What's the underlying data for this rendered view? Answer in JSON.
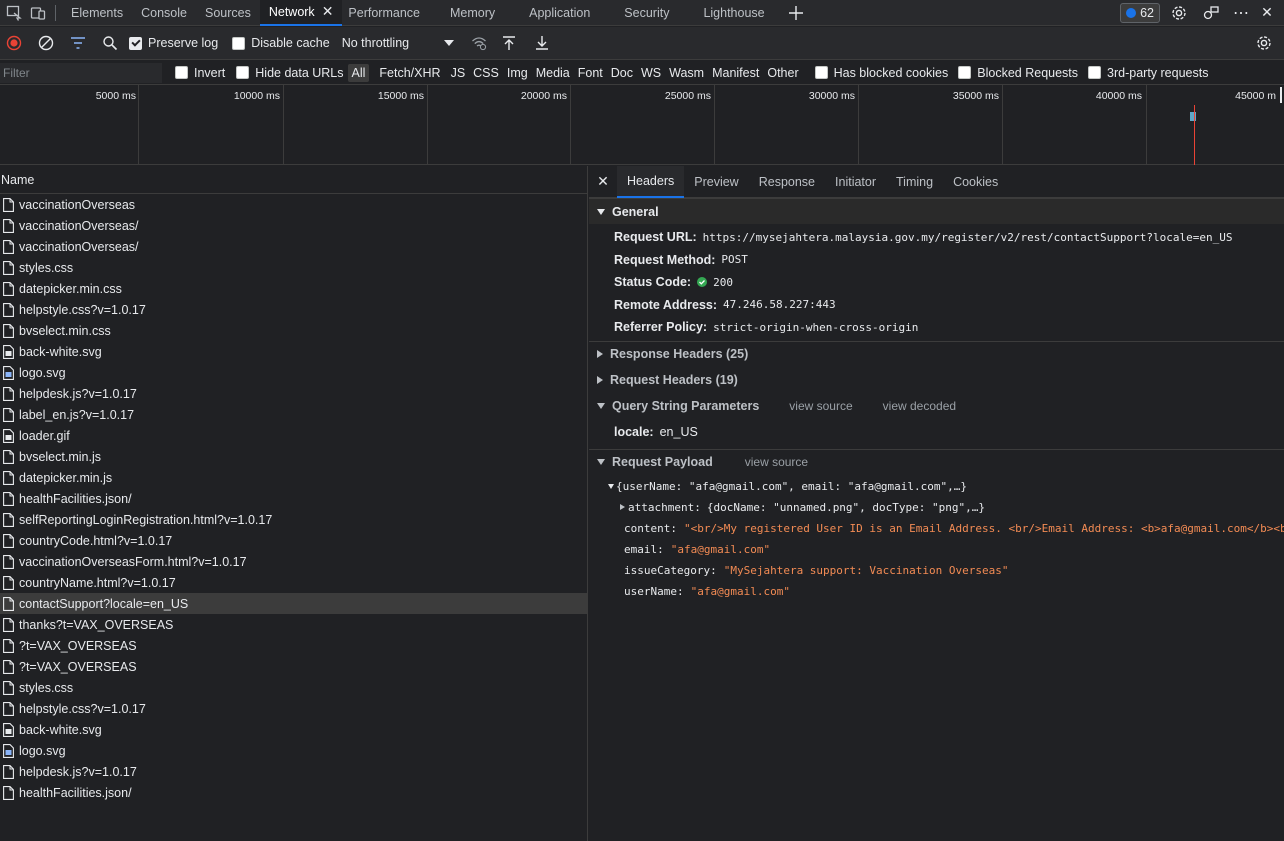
{
  "topbar": {
    "tabs": [
      {
        "label": "Elements",
        "active": false
      },
      {
        "label": "Console",
        "active": false
      },
      {
        "label": "Sources",
        "active": false
      },
      {
        "label": "Network",
        "active": true
      },
      {
        "label": "Performance",
        "active": false
      },
      {
        "label": "Memory",
        "active": false
      },
      {
        "label": "Application",
        "active": false
      },
      {
        "label": "Security",
        "active": false
      },
      {
        "label": "Lighthouse",
        "active": false
      }
    ],
    "issues_count": "62"
  },
  "toolbar": {
    "preserve_log_label": "Preserve log",
    "preserve_log_checked": true,
    "disable_cache_label": "Disable cache",
    "disable_cache_checked": false,
    "throttling": "No throttling"
  },
  "filterbar": {
    "filter_placeholder": "Filter",
    "invert_label": "Invert",
    "hide_data_urls_label": "Hide data URLs",
    "types": [
      "All",
      "Fetch/XHR",
      "JS",
      "CSS",
      "Img",
      "Media",
      "Font",
      "Doc",
      "WS",
      "Wasm",
      "Manifest",
      "Other"
    ],
    "active_type": "All",
    "has_blocked_cookies_label": "Has blocked cookies",
    "blocked_requests_label": "Blocked Requests",
    "third_party_label": "3rd-party requests"
  },
  "overview": {
    "ticks": [
      "5000 ms",
      "10000 ms",
      "15000 ms",
      "20000 ms",
      "25000 ms",
      "30000 ms",
      "35000 ms",
      "40000 ms",
      "45000 m"
    ]
  },
  "list": {
    "header": "Name",
    "rows": [
      {
        "name": "vaccinationOverseas",
        "icon": "doc-icon"
      },
      {
        "name": "vaccinationOverseas/",
        "icon": "doc-icon"
      },
      {
        "name": "vaccinationOverseas/",
        "icon": "doc-icon"
      },
      {
        "name": "styles.css",
        "icon": "doc-icon"
      },
      {
        "name": "datepicker.min.css",
        "icon": "doc-icon"
      },
      {
        "name": "helpstyle.css?v=1.0.17",
        "icon": "doc-icon"
      },
      {
        "name": "bvselect.min.css",
        "icon": "doc-icon"
      },
      {
        "name": "back-white.svg",
        "icon": "image-icon"
      },
      {
        "name": "logo.svg",
        "icon": "image-color-icon"
      },
      {
        "name": "helpdesk.js?v=1.0.17",
        "icon": "doc-icon"
      },
      {
        "name": "label_en.js?v=1.0.17",
        "icon": "doc-icon"
      },
      {
        "name": "loader.gif",
        "icon": "image-icon"
      },
      {
        "name": "bvselect.min.js",
        "icon": "doc-icon"
      },
      {
        "name": "datepicker.min.js",
        "icon": "doc-icon"
      },
      {
        "name": "healthFacilities.json/",
        "icon": "doc-icon"
      },
      {
        "name": "selfReportingLoginRegistration.html?v=1.0.17",
        "icon": "doc-icon"
      },
      {
        "name": "countryCode.html?v=1.0.17",
        "icon": "doc-icon"
      },
      {
        "name": "vaccinationOverseasForm.html?v=1.0.17",
        "icon": "doc-icon"
      },
      {
        "name": "countryName.html?v=1.0.17",
        "icon": "doc-icon"
      },
      {
        "name": "contactSupport?locale=en_US",
        "icon": "doc-icon",
        "selected": true
      },
      {
        "name": "thanks?t=VAX_OVERSEAS",
        "icon": "doc-icon"
      },
      {
        "name": "?t=VAX_OVERSEAS",
        "icon": "doc-icon"
      },
      {
        "name": "?t=VAX_OVERSEAS",
        "icon": "doc-icon"
      },
      {
        "name": "styles.css",
        "icon": "doc-icon"
      },
      {
        "name": "helpstyle.css?v=1.0.17",
        "icon": "doc-icon"
      },
      {
        "name": "back-white.svg",
        "icon": "image-icon"
      },
      {
        "name": "logo.svg",
        "icon": "image-color-icon"
      },
      {
        "name": "helpdesk.js?v=1.0.17",
        "icon": "doc-icon"
      },
      {
        "name": "healthFacilities.json/",
        "icon": "doc-icon"
      }
    ]
  },
  "details": {
    "tabs": [
      "Headers",
      "Preview",
      "Response",
      "Initiator",
      "Timing",
      "Cookies"
    ],
    "active_tab": "Headers",
    "general": {
      "title": "General",
      "request_url_label": "Request URL:",
      "request_url": "https://mysejahtera.malaysia.gov.my/register/v2/rest/contactSupport?locale=en_US",
      "request_method_label": "Request Method:",
      "request_method": "POST",
      "status_code_label": "Status Code:",
      "status_code": "200",
      "remote_address_label": "Remote Address:",
      "remote_address": "47.246.58.227:443",
      "referrer_policy_label": "Referrer Policy:",
      "referrer_policy": "strict-origin-when-cross-origin"
    },
    "response_headers": "Response Headers (25)",
    "request_headers": "Request Headers (19)",
    "query": {
      "title": "Query String Parameters",
      "view_source": "view source",
      "view_decoded": "view decoded",
      "param_key": "locale:",
      "param_value": "en_US"
    },
    "payload": {
      "title": "Request Payload",
      "view_source": "view source",
      "summary": "{userName: \"afa@gmail.com\", email: \"afa@gmail.com\",…}",
      "attachment_key": "attachment:",
      "attachment_val": "{docName: \"unnamed.png\", docType: \"png\",…}",
      "content_key": "content:",
      "content_val": "\"<br/>My registered User ID is an Email Address. <br/>Email Address: <b>afa@gmail.com</b><b",
      "email_key": "email:",
      "email_val": "\"afa@gmail.com\"",
      "issue_key": "issueCategory:",
      "issue_val": "\"MySejahtera support: Vaccination Overseas\"",
      "username_key": "userName:",
      "username_val": "\"afa@gmail.com\""
    }
  },
  "colors": {
    "accent": "#1a73e8",
    "record": "#ea4335",
    "status_ok": "#34a853",
    "string": "#f28b54"
  }
}
